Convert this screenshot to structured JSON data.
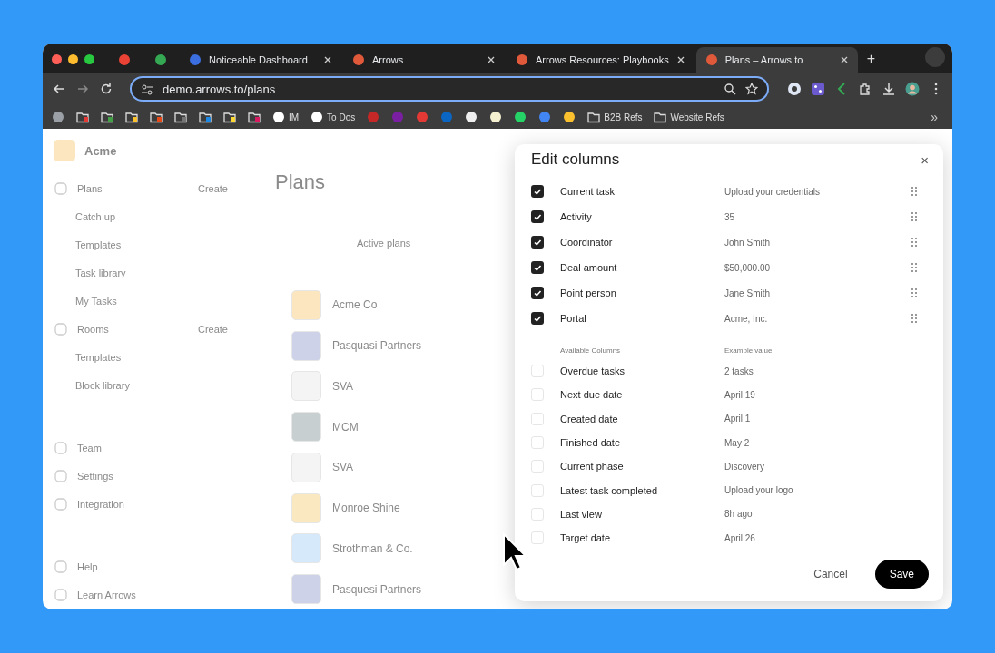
{
  "browser": {
    "tabs": [
      {
        "kind": "pinned",
        "color": "#ea4335",
        "selected": false
      },
      {
        "kind": "pinned",
        "color": "#34a853",
        "selected": false
      },
      {
        "kind": "page",
        "title": "Noticeable Dashboard",
        "color": "#3b6fe0",
        "selected": false
      },
      {
        "kind": "page",
        "title": "Arrows",
        "color": "#e0593b",
        "selected": false
      },
      {
        "kind": "page",
        "title": "Arrows Resources: Playbooks",
        "color": "#e0593b",
        "selected": false
      },
      {
        "kind": "page",
        "title": "Plans – Arrows.to",
        "color": "#e0593b",
        "selected": true
      }
    ],
    "new_tab": "+",
    "url": "demo.arrows.to/plans",
    "bookmarks": [
      {
        "kind": "site",
        "color": "#9aa0a6"
      },
      {
        "kind": "folder",
        "color": "#e53935"
      },
      {
        "kind": "folder",
        "color": "#43a047"
      },
      {
        "kind": "folder",
        "color": "#fbc02d"
      },
      {
        "kind": "folder",
        "color": "#e64a19"
      },
      {
        "kind": "folder",
        "color": "#757575"
      },
      {
        "kind": "folder",
        "color": "#1e88e5"
      },
      {
        "kind": "folder",
        "color": "#fdd835"
      },
      {
        "kind": "folder",
        "color": "#d81b60"
      },
      {
        "kind": "site",
        "label": "IM",
        "color": "#ffffff"
      },
      {
        "kind": "site",
        "label": "To Dos",
        "color": "#ffffff"
      },
      {
        "kind": "site",
        "color": "#c62828"
      },
      {
        "kind": "site",
        "color": "#7b1fa2"
      },
      {
        "kind": "site",
        "color": "#e53935"
      },
      {
        "kind": "site",
        "color": "#0a66c2"
      },
      {
        "kind": "site",
        "color": "#eeeeee"
      },
      {
        "kind": "site",
        "color": "#f5f0d0"
      },
      {
        "kind": "site",
        "color": "#25d366"
      },
      {
        "kind": "site",
        "color": "#4285f4"
      },
      {
        "kind": "site",
        "color": "#fbc02d"
      },
      {
        "kind": "folder",
        "label": "B2B Refs"
      },
      {
        "kind": "folder",
        "label": "Website Refs"
      }
    ],
    "more": "»"
  },
  "sidebar": {
    "workspace": "Acme",
    "groups": [
      [
        {
          "label": "Plans",
          "action": "Create",
          "children": [
            {
              "label": "Catch up"
            },
            {
              "label": "Templates"
            },
            {
              "label": "Task library"
            },
            {
              "label": "My Tasks"
            }
          ]
        },
        {
          "label": "Rooms",
          "action": "Create",
          "children": [
            {
              "label": "Templates"
            },
            {
              "label": "Block library"
            }
          ]
        }
      ],
      [
        {
          "label": "Team"
        },
        {
          "label": "Settings"
        },
        {
          "label": "Integration"
        }
      ],
      [
        {
          "label": "Help"
        },
        {
          "label": "Learn Arrows"
        }
      ]
    ]
  },
  "main": {
    "title": "Plans",
    "filters": [
      "Active plans"
    ],
    "plans": [
      {
        "name": "Acme Co",
        "color": "#fbe6bf"
      },
      {
        "name": "Pasquasi Partners",
        "color": "#cdd2e8"
      },
      {
        "name": "SVA",
        "color": "#f4f4f4"
      },
      {
        "name": "MCM",
        "color": "#c7cfd0"
      },
      {
        "name": "SVA",
        "color": "#f4f4f4"
      },
      {
        "name": "Monroe Shine",
        "color": "#fae9c0"
      },
      {
        "name": "Strothman & Co.",
        "color": "#d6e9fa"
      },
      {
        "name": "Pasquesi Partners",
        "color": "#cdd2e8"
      }
    ]
  },
  "dialog": {
    "title": "Edit columns",
    "close": "×",
    "columns": [
      {
        "name": "Current task",
        "example": "Upload your credentials",
        "checked": true
      },
      {
        "name": "Activity",
        "example": "35",
        "checked": true
      },
      {
        "name": "Coordinator",
        "example": "John Smith",
        "checked": true
      },
      {
        "name": "Deal amount",
        "example": "$50,000.00",
        "checked": true
      },
      {
        "name": "Point person",
        "example": "Jane Smith",
        "checked": true
      },
      {
        "name": "Portal",
        "example": "Acme, Inc.",
        "checked": true
      }
    ],
    "available_header": {
      "name": "Available Columns",
      "example": "Example value"
    },
    "available": [
      {
        "name": "Overdue tasks",
        "example": "2 tasks",
        "checked": false
      },
      {
        "name": "Next due date",
        "example": "April 19",
        "checked": false
      },
      {
        "name": "Created date",
        "example": "April 1",
        "checked": false
      },
      {
        "name": "Finished date",
        "example": "May 2",
        "checked": false
      },
      {
        "name": "Current phase",
        "example": "Discovery",
        "checked": false
      },
      {
        "name": "Latest task completed",
        "example": "Upload your logo",
        "checked": false
      },
      {
        "name": "Last view",
        "example": "8h ago",
        "checked": false
      },
      {
        "name": "Target date",
        "example": "April 26",
        "checked": false
      }
    ],
    "buttons": [
      {
        "label": "Cancel",
        "kind": "secondary"
      },
      {
        "label": "Save",
        "kind": "primary"
      }
    ]
  }
}
